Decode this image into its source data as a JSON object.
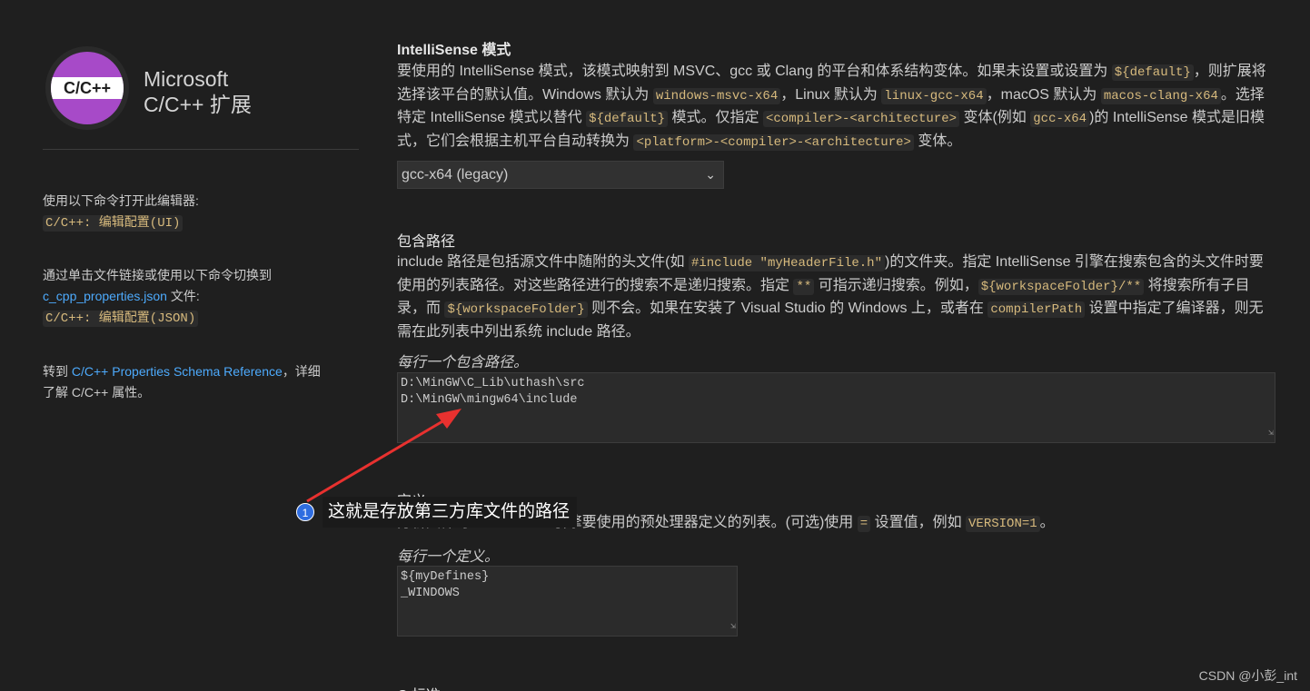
{
  "sidebar": {
    "logo_text": "C/C++",
    "brand_line1": "Microsoft",
    "brand_line2": "C/C++ 扩展",
    "open_editor_text": "使用以下命令打开此编辑器:",
    "open_editor_cmd": "C/C++: 编辑配置(UI)",
    "switch_text": "通过单击文件链接或使用以下命令切换到",
    "switch_file_link": "c_cpp_properties.json",
    "switch_file_suffix": " 文件:",
    "switch_cmd": "C/C++: 编辑配置(JSON)",
    "goto_prefix": "转到 ",
    "goto_link": "C/C++ Properties Schema Reference",
    "goto_suffix_line1": "，详细",
    "goto_suffix_line2": "了解 C/C++ 属性。"
  },
  "intellisense": {
    "title": "IntelliSense 模式",
    "desc": {
      "t1": "要使用的 IntelliSense 模式，该模式映射到 MSVC、gcc 或 Clang 的平台和体系结构变体。如果未设置或设置为 ",
      "c1": "${default}",
      "t2": "，则扩展将选择该平台的默认值。Windows 默认为 ",
      "c2": "windows-msvc-x64",
      "t3": "，Linux 默认为 ",
      "c3": "linux-gcc-x64",
      "t4": "，macOS 默认为 ",
      "c4": "macos-clang-x64",
      "t5": "。选择特定 IntelliSense 模式以替代 ",
      "c5": "${default}",
      "t6": " 模式。仅指定 ",
      "c6": "<compiler>-<architecture>",
      "t7": " 变体(例如 ",
      "c7": "gcc-x64",
      "t8": ")的 IntelliSense 模式是旧模式，它们会根据主机平台自动转换为 ",
      "c8": "<platform>-<compiler>-<architecture>",
      "t9": " 变体。"
    },
    "selected": "gcc-x64 (legacy)"
  },
  "include": {
    "title": "包含路径",
    "desc": {
      "t1": "include 路径是包括源文件中随附的头文件(如 ",
      "c1": "#include \"myHeaderFile.h\"",
      "t2": ")的文件夹。指定 IntelliSense 引擎在搜索包含的头文件时要使用的列表路径。对这些路径进行的搜索不是递归搜索。指定 ",
      "c2": "**",
      "t3": " 可指示递归搜索。例如，",
      "c3": "${workspaceFolder}/**",
      "t4": " 将搜索所有子目录，而 ",
      "c4": "${workspaceFolder}",
      "t5": " 则不会。如果在安装了 Visual Studio 的 Windows 上，或者在 ",
      "c5": "compilerPath",
      "t6": " 设置中指定了编译器，则无需在此列表中列出系统 include 路径。"
    },
    "hint": "每行一个包含路径。",
    "lines": [
      "D:\\MinGW\\C_Lib\\uthash\\src",
      "D:\\MinGW\\mingw64\\include"
    ]
  },
  "defines": {
    "title": "定义",
    "desc": {
      "t1": "分析文件时 IntelliSense 引擎要使用的预处理器定义的列表。(可选)使用 ",
      "c1": "=",
      "t2": " 设置值，例如 ",
      "c2": "VERSION=1",
      "t3": "。"
    },
    "hint": "每行一个定义。",
    "lines": [
      "${myDefines}",
      "_WINDOWS"
    ]
  },
  "next_section_title": "C 标准",
  "annotation": {
    "number": "1",
    "text": "这就是存放第三方库文件的路径",
    "arrow_color": "#e8312f"
  },
  "watermark": "CSDN @小彭_int",
  "colors": {
    "background": "#1f1f1f",
    "code_text": "#d7ba7d",
    "link": "#4daafc",
    "logo_purple": "#a74ac8"
  }
}
